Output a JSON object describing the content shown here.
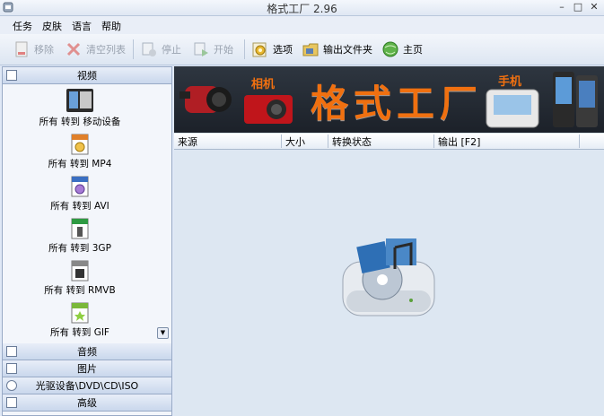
{
  "window": {
    "title": "格式工厂 2.96"
  },
  "menu": [
    "任务",
    "皮肤",
    "语言",
    "帮助"
  ],
  "toolbar": {
    "remove": "移除",
    "clear_list": "清空列表",
    "stop": "停止",
    "start": "开始",
    "options": "选项",
    "output_folder": "输出文件夹",
    "home": "主页"
  },
  "sidebar": {
    "video": "视频",
    "audio": "音频",
    "image": "图片",
    "rom": "光驱设备\\DVD\\CD\\ISO",
    "advanced": "高级",
    "video_items": [
      {
        "label": "所有 转到 移动设备",
        "icon": "mobile-device-icon"
      },
      {
        "label": "所有 转到 MP4",
        "icon": "mp4-icon"
      },
      {
        "label": "所有 转到 AVI",
        "icon": "avi-icon"
      },
      {
        "label": "所有 转到 3GP",
        "icon": "3gp-icon"
      },
      {
        "label": "所有 转到 RMVB",
        "icon": "rmvb-icon"
      },
      {
        "label": "所有 转到 GIF",
        "icon": "gif-icon"
      }
    ]
  },
  "banner": {
    "title": "格式工厂",
    "camera": "相机",
    "phone": "手机"
  },
  "table": {
    "columns": [
      "来源",
      "大小",
      "转换状态",
      "输出 [F2]"
    ]
  },
  "colors": {
    "accent": "#f07010",
    "panel": "#dde7f2",
    "sidebar_border": "#98aac6"
  }
}
